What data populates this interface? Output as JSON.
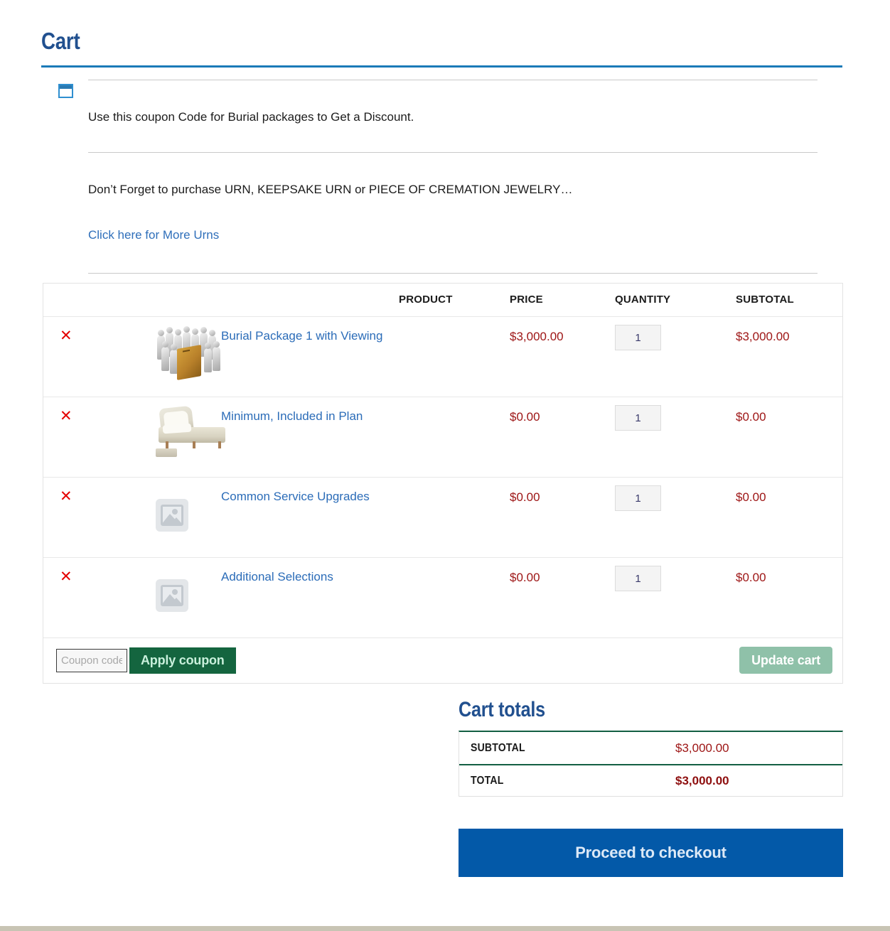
{
  "page": {
    "title": "Cart",
    "accent_blue": "#1b7ab8",
    "heading_color": "#21508f",
    "price_color": "#9d1414",
    "link_color": "#2b6cb8"
  },
  "notice": {
    "icon": "broken-image-icon",
    "coupon_text": "Use this coupon Code for Burial packages to Get a Discount.",
    "urn_text": "Don’t Forget to purchase URN, KEEPSAKE URN or PIECE OF CREMATION JEWELRY…",
    "urn_link": "Click here for More Urns"
  },
  "cart_table": {
    "headers": {
      "product": "PRODUCT",
      "price": "PRICE",
      "quantity": "QUANTITY",
      "subtotal": "SUBTOTAL"
    },
    "remove_glyph": "✕",
    "rows": [
      {
        "name": "Burial Package 1 with Viewing",
        "price": "$3,000.00",
        "quantity": "1",
        "subtotal": "$3,000.00",
        "image": "burial-package-crowd-casket-image"
      },
      {
        "name": "Minimum, Included in Plan",
        "price": "$0.00",
        "quantity": "1",
        "subtotal": "$0.00",
        "image": "cream-casket-image"
      },
      {
        "name": "Common Service Upgrades",
        "price": "$0.00",
        "quantity": "1",
        "subtotal": "$0.00",
        "image": "placeholder-image"
      },
      {
        "name": "Additional Selections",
        "price": "$0.00",
        "quantity": "1",
        "subtotal": "$0.00",
        "image": "placeholder-image"
      }
    ]
  },
  "coupon": {
    "placeholder": "Coupon code",
    "value": "",
    "apply_label": "Apply coupon",
    "update_label": "Update cart",
    "apply_color": "#14653f",
    "update_color": "#8fc1a9"
  },
  "totals": {
    "title": "Cart totals",
    "subtotal_label": "SUBTOTAL",
    "subtotal_value": "$3,000.00",
    "total_label": "TOTAL",
    "total_value": "$3,000.00",
    "checkout_label": "Proceed to checkout",
    "checkout_color": "#0359a8"
  }
}
